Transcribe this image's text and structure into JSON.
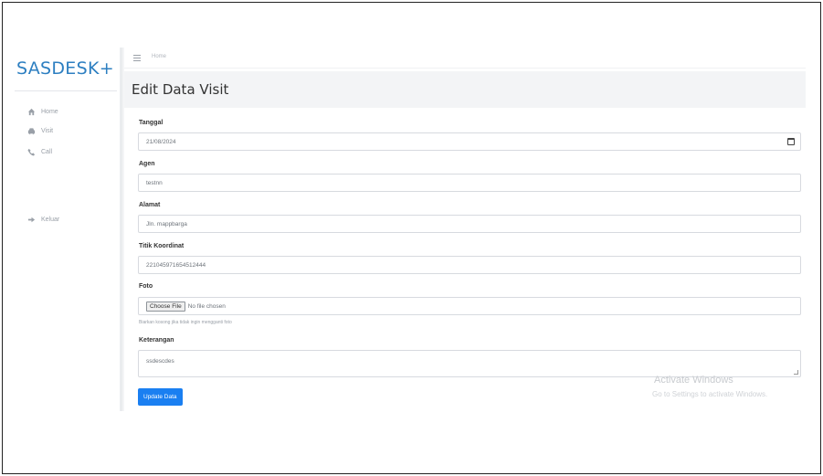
{
  "app": {
    "brand": "SASDESK+"
  },
  "sidebar": {
    "items": [
      {
        "label": "Home",
        "icon": "home-icon"
      },
      {
        "label": "Visit",
        "icon": "car-icon"
      },
      {
        "label": "Call",
        "icon": "phone-icon"
      },
      {
        "label": "Keluar",
        "icon": "logout-icon"
      }
    ]
  },
  "topbar": {
    "breadcrumb": "Home"
  },
  "page": {
    "title": "Edit Data Visit"
  },
  "form": {
    "tanggal": {
      "label": "Tanggal",
      "value": "21/08/2024"
    },
    "agen": {
      "label": "Agen",
      "value": "testnn"
    },
    "alamat": {
      "label": "Alamat",
      "value": "Jln. mappbarga"
    },
    "titik": {
      "label": "Titik Koordinat",
      "value": "221045971654512444"
    },
    "foto": {
      "label": "Foto",
      "button": "Choose File",
      "status": "No file chosen",
      "help": "Biarkan kosong jika tidak ingin mengganti foto"
    },
    "keterangan": {
      "label": "Keterangan",
      "value": "ssdescdes"
    },
    "submit": "Update Data"
  },
  "watermark": {
    "line1": "Activate Windows",
    "line2": "Go to Settings to activate Windows."
  },
  "colors": {
    "brand": "#2d7fc1",
    "primary_button": "#1a7ff1",
    "title_bar": "#f3f4f6"
  }
}
